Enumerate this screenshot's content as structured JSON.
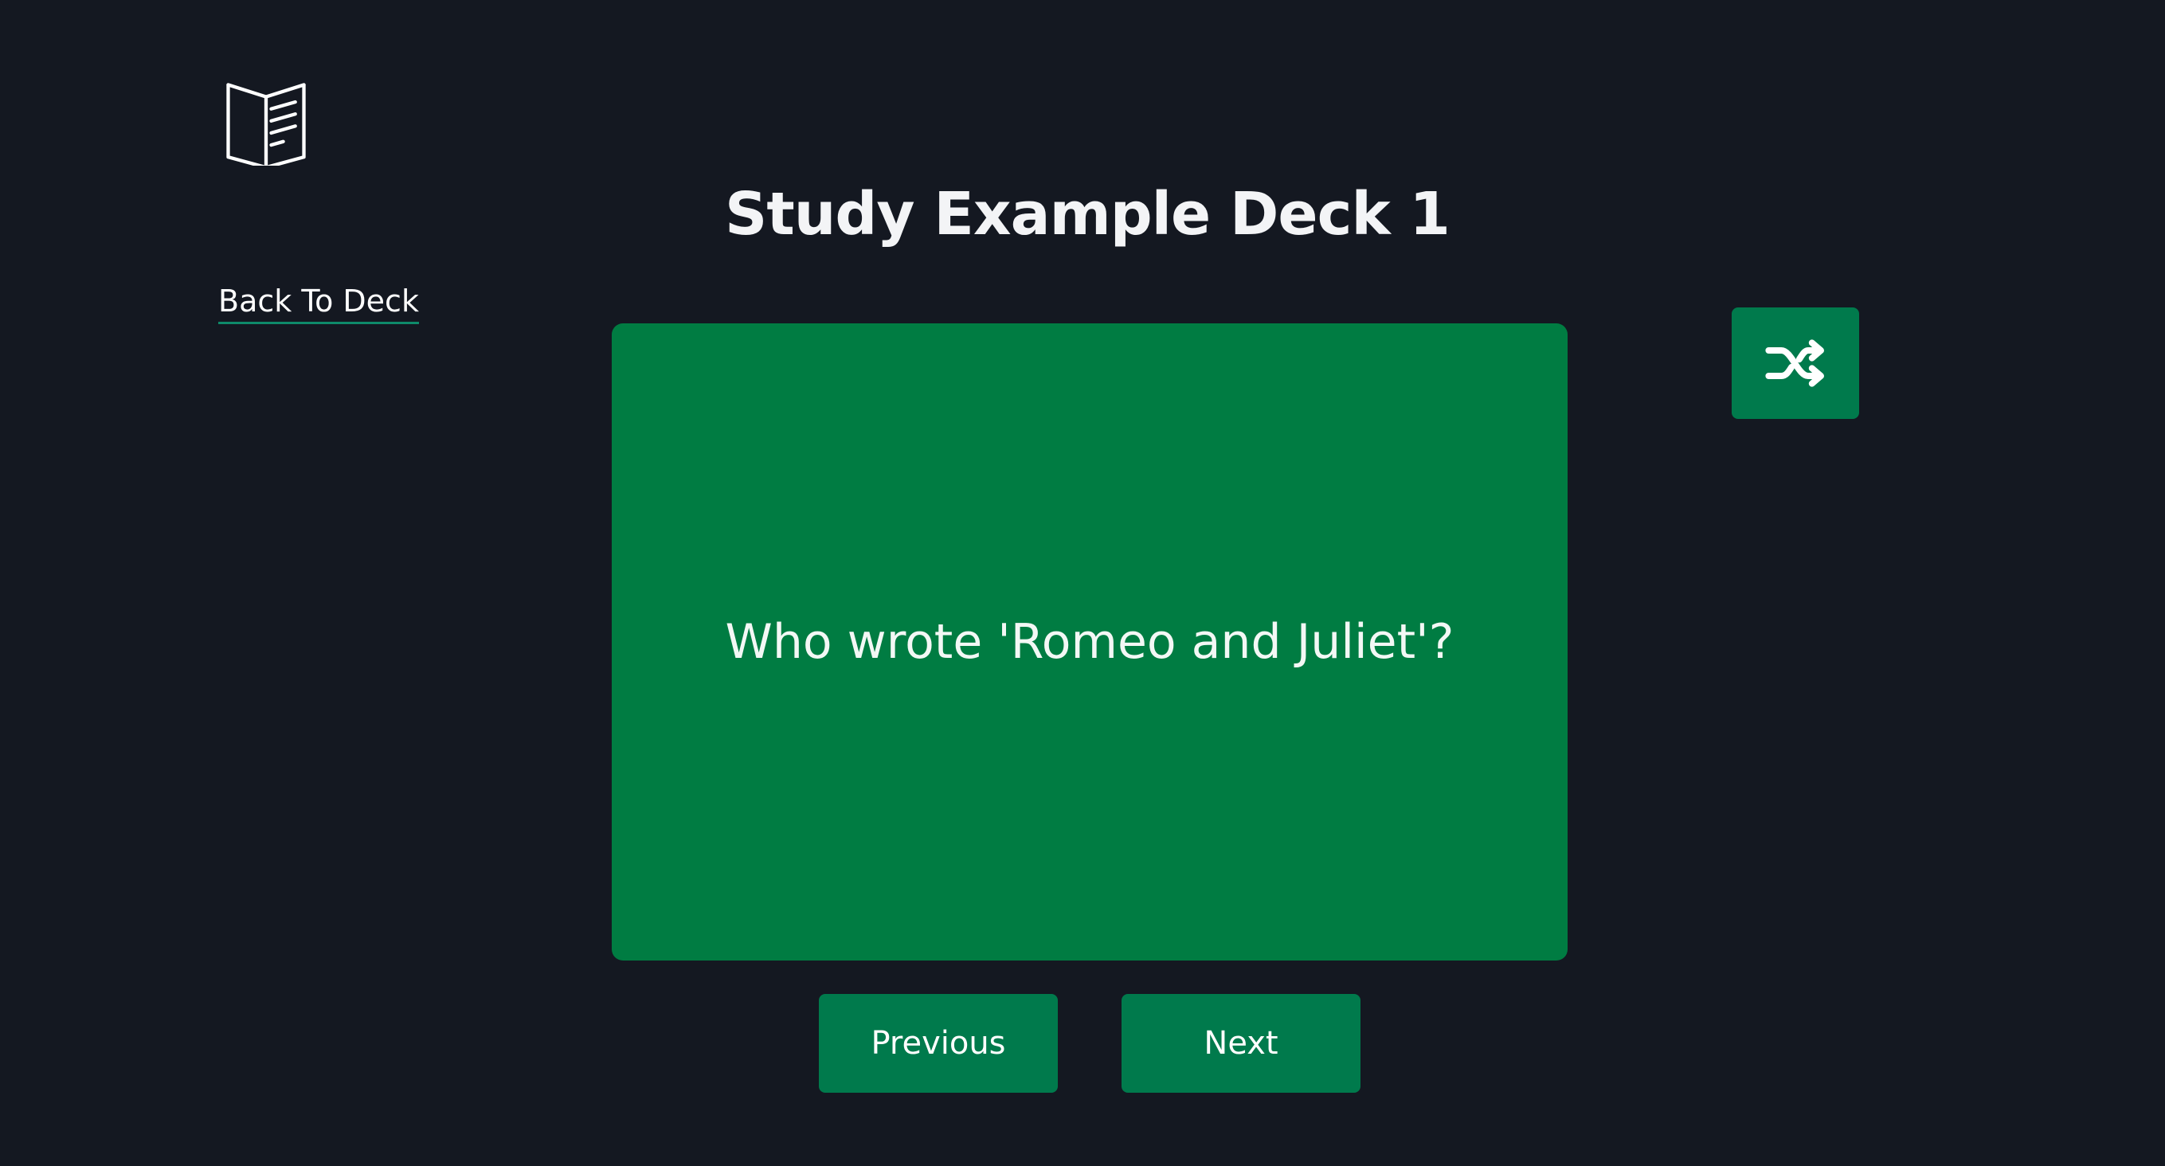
{
  "header": {
    "logo_icon": "open-book-icon",
    "title": "Study Example Deck 1"
  },
  "nav": {
    "back_label": "Back To Deck"
  },
  "card": {
    "text": "Who wrote 'Romeo and Juliet'?",
    "color": "#007c42"
  },
  "controls": {
    "shuffle_icon": "shuffle-icon",
    "previous_label": "Previous",
    "next_label": "Next",
    "button_color": "#007a4c"
  },
  "theme": {
    "background": "#141821",
    "link_underline": "#0e8a6a"
  }
}
